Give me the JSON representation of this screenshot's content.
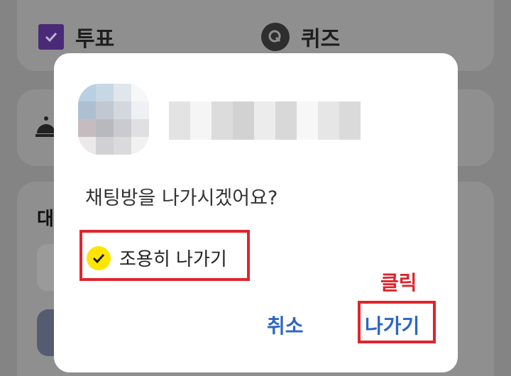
{
  "background": {
    "vote_label": "투표",
    "quiz_label": "퀴즈",
    "section_heading": "대"
  },
  "dialog": {
    "question": "채팅방을 나가시겠어요?",
    "option_label": "조용히 나가기",
    "option_checked": true,
    "cancel_label": "취소",
    "leave_label": "나가기"
  },
  "annotation": {
    "click_note": "클릭"
  },
  "colors": {
    "accent_yellow": "#fee500",
    "button_blue": "#2b66c2",
    "annotation_red": "#e0242c"
  }
}
